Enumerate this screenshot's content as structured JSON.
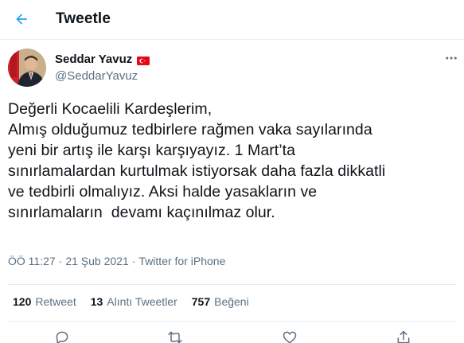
{
  "header": {
    "title": "Tweetle",
    "back_icon": "arrow-left-icon"
  },
  "tweet": {
    "author": {
      "name": "Seddar Yavuz",
      "handle": "@SeddarYavuz",
      "flag_icon": "turkey-flag-icon"
    },
    "text_lines": [
      "Değerli Kocaelili Kardeşlerim,",
      "Almış olduğumuz tedbirlere rağmen vaka sayılarında",
      "yeni bir artış ile karşı karşıyayız. 1 Mart’ta",
      "sınırlamalardan kurtulmak istiyorsak daha fazla dikkatli",
      "ve tedbirli olmalıyız. Aksi halde yasakların ve",
      "sınırlamaların  devamı kaçınılmaz olur."
    ],
    "time": "ÖÖ 11:27",
    "date": "21 Şub 2021",
    "source": "Twitter for iPhone",
    "separator": "·"
  },
  "stats": {
    "retweets": {
      "count": "120",
      "label": "Retweet"
    },
    "quotes": {
      "count": "13",
      "label": "Alıntı Tweetler"
    },
    "likes": {
      "count": "757",
      "label": "Beğeni"
    }
  },
  "actions": [
    "reply-icon",
    "retweet-icon",
    "like-icon",
    "share-icon"
  ],
  "colors": {
    "accent": "#1da1f2",
    "text": "#0f1419",
    "secondary": "#5b7083",
    "divider": "#e6ecf0",
    "flag_red": "#e30a17"
  }
}
